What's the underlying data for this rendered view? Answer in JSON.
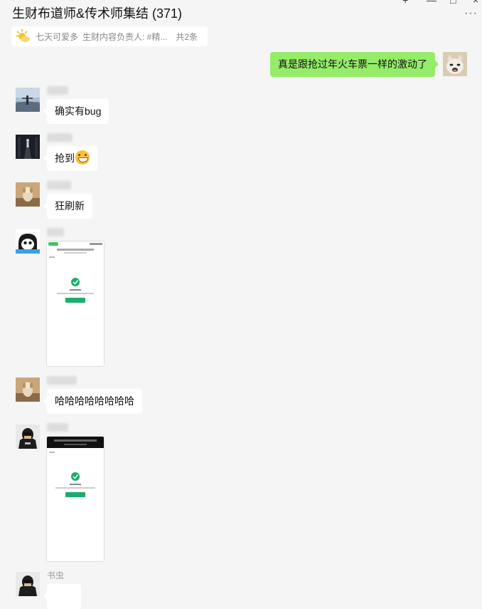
{
  "window": {
    "title": "生财布道师&传术师集结 (371)",
    "controls": [
      "+",
      "—",
      "□",
      "×"
    ],
    "more": "···"
  },
  "pinned": {
    "sender": "七天可爱多",
    "snippet": "生财内容负责人: #精...",
    "count": "共2条"
  },
  "messages": [
    {
      "side": "right",
      "text": "真是跟抢过年火车票一样的激动了",
      "avatar": "cat-avatar"
    },
    {
      "side": "left",
      "type": "text",
      "text": "确实有bug",
      "avatar": "landscape-avatar"
    },
    {
      "side": "left",
      "type": "text-emoji",
      "text": "抢到",
      "emoji": "grinning-emoji",
      "avatar": "night-road-avatar"
    },
    {
      "side": "left",
      "type": "text",
      "text": "狂刷新",
      "avatar": "dog-avatar"
    },
    {
      "side": "left",
      "type": "image",
      "avatar": "cartoon-avatar"
    },
    {
      "side": "left",
      "type": "text",
      "text": "哈哈哈哈哈哈哈哈",
      "avatar": "dog-avatar"
    },
    {
      "side": "left",
      "type": "image",
      "avatar": "hoodie-avatar"
    },
    {
      "side": "left",
      "type": "text",
      "name": "书虫",
      "avatar": "hoodie-avatar"
    }
  ],
  "colors": {
    "self_bubble": "#95ec69",
    "background": "#f5f5f5",
    "check": "#1aad6e"
  }
}
